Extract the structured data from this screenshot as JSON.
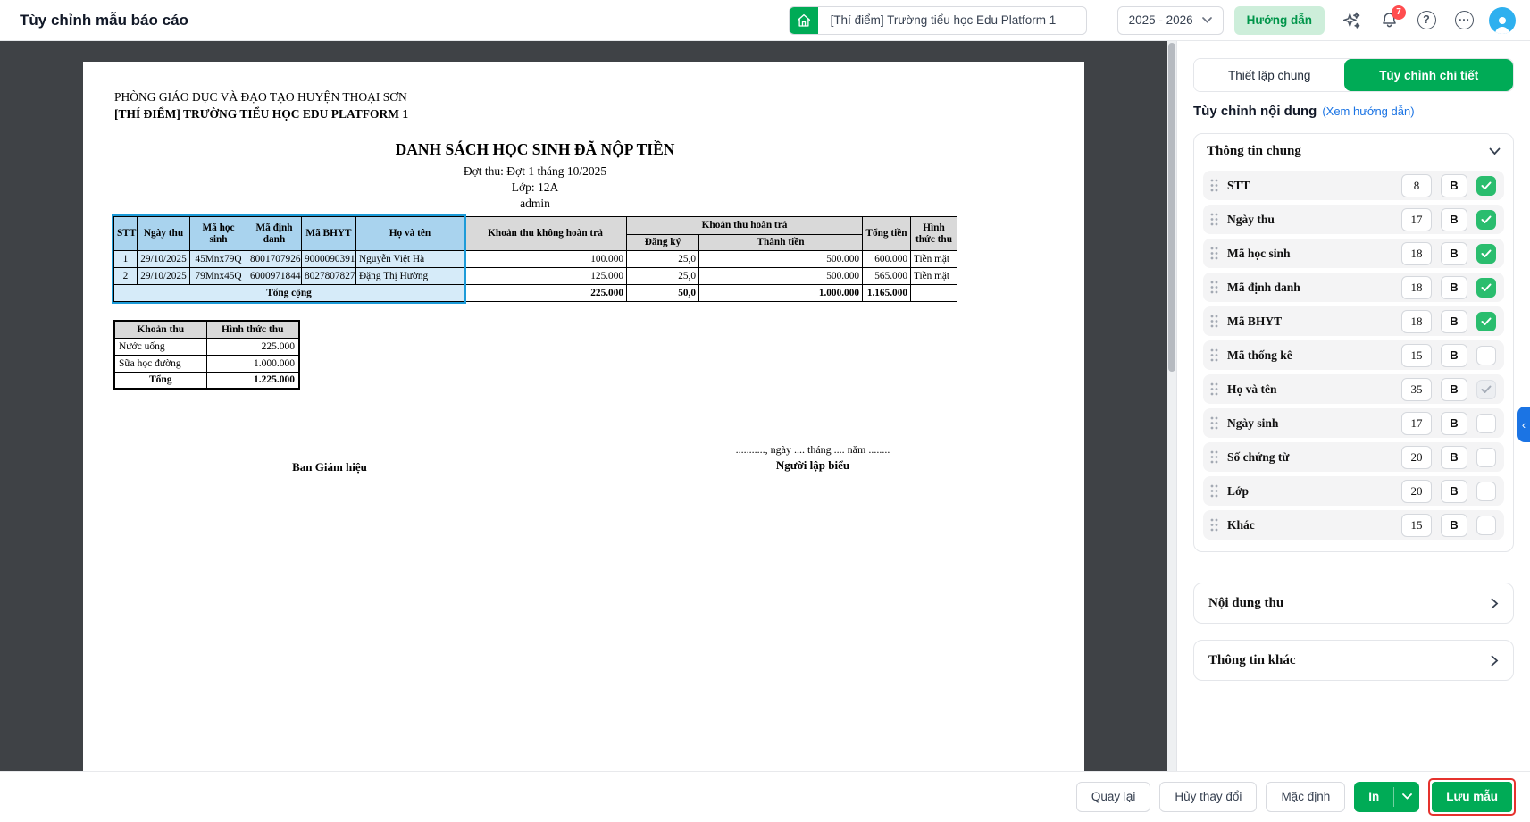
{
  "colors": {
    "accent": "#00ab56",
    "accent_soft": "#cdeeda",
    "accent_text": "#00954a",
    "link": "#1b74e4",
    "badge": "#ff4d4f",
    "canvas": "#3f4246",
    "selection": "#1d9bd8",
    "table_header": "#d9d9d9",
    "table_header_blue": "#a9d3ee",
    "table_cell_blue": "#d6ebf9",
    "checkbox": "#2abd6e",
    "save_highlight": "#e5322d",
    "avatar": "#2eb0ef"
  },
  "topbar": {
    "title": "Tùy chỉnh mẫu báo cáo",
    "school": "[Thí điểm] Trường tiểu học Edu Platform 1",
    "year": "2025 - 2026",
    "guide_button": "Hướng dẫn",
    "notification_count": "7",
    "help_glyph": "?",
    "more_glyph": "⋯"
  },
  "document": {
    "department": "PHÒNG GIÁO DỤC VÀ ĐẠO TẠO HUYỆN THOẠI SƠN",
    "school_name": "[THÍ ĐIỂM] TRƯỜNG TIỂU HỌC EDU PLATFORM 1",
    "title": "DANH SÁCH HỌC SINH ĐÃ NỘP TIỀN",
    "period": "Đợt thu: Đợt 1 tháng 10/2025",
    "class_line": "Lớp: 12A",
    "creator": "admin",
    "main_table": {
      "col_headers": {
        "stt": "STT",
        "ngay_thu": "Ngày thu",
        "ma_hoc_sinh": "Mã học sinh",
        "ma_dinh_danh": "Mã định danh",
        "ma_bhyt": "Mã BHYT",
        "ho_va_ten": "Họ và tên",
        "khoan_thu_khong_hoan_tra": "Khoản thu không hoàn trả",
        "khoan_thu_hoan_tra": "Khoản thu hoàn trả",
        "dang_ky": "Đăng ký",
        "thanh_tien": "Thành tiền",
        "tong_tien": "Tổng tiền",
        "hinh_thuc_thu": "Hình thức thu"
      },
      "rows": [
        [
          "1",
          "29/10/2025",
          "45Mnx79Q",
          "8001707926",
          "9000090391",
          "Nguyễn Việt Hà",
          "100.000",
          "25,0",
          "500.000",
          "600.000",
          "Tiền mặt"
        ],
        [
          "2",
          "29/10/2025",
          "79Mnx45Q",
          "6000971844",
          "8027807827",
          "Đặng Thị Hường",
          "125.000",
          "25,0",
          "500.000",
          "565.000",
          "Tiền mặt"
        ]
      ],
      "total_label": "Tổng cộng",
      "totals": [
        "225.000",
        "50,0",
        "1.000.000",
        "1.165.000",
        ""
      ]
    },
    "summary_table": {
      "headers": [
        "Khoản thu",
        "Hình thức thu"
      ],
      "rows": [
        [
          "Nước uống",
          "225.000"
        ],
        [
          "Sữa học đường",
          "1.000.000"
        ]
      ],
      "total_label": "Tổng",
      "total_value": "1.225.000"
    },
    "signature": {
      "left_title": "Ban Giám hiệu",
      "date_line": "..........., ngày .... tháng .... năm ........",
      "right_title": "Người lập biểu"
    }
  },
  "sidebar": {
    "tabs": [
      {
        "label": "Thiết lập chung",
        "active": false
      },
      {
        "label": "Tùy chỉnh chi tiết",
        "active": true
      }
    ],
    "heading": "Tùy chỉnh nội dung",
    "guide_link": "(Xem hướng dẫn)",
    "bold_button_label": "B",
    "collapse_glyph": "‹",
    "sections": {
      "general": {
        "title": "Thông tin chung",
        "fields": [
          {
            "label": "STT",
            "width": "8",
            "state": "checked"
          },
          {
            "label": "Ngày thu",
            "width": "17",
            "state": "checked"
          },
          {
            "label": "Mã học sinh",
            "width": "18",
            "state": "checked"
          },
          {
            "label": "Mã định danh",
            "width": "18",
            "state": "checked"
          },
          {
            "label": "Mã BHYT",
            "width": "18",
            "state": "checked"
          },
          {
            "label": "Mã thống kê",
            "width": "15",
            "state": "unchecked"
          },
          {
            "label": "Họ và tên",
            "width": "35",
            "state": "disabled"
          },
          {
            "label": "Ngày sinh",
            "width": "17",
            "state": "unchecked"
          },
          {
            "label": "Số chứng từ",
            "width": "20",
            "state": "unchecked"
          },
          {
            "label": "Lớp",
            "width": "20",
            "state": "unchecked"
          },
          {
            "label": "Khác",
            "width": "15",
            "state": "unchecked"
          }
        ]
      },
      "collapsed": [
        "Nội dung thu",
        "Thông tin khác"
      ]
    }
  },
  "footer": {
    "back": "Quay lại",
    "discard": "Hủy thay đổi",
    "default": "Mặc định",
    "print": "In",
    "save": "Lưu mẫu"
  }
}
